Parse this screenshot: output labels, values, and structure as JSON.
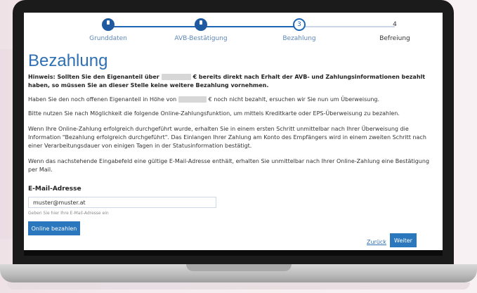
{
  "stepper": {
    "steps": [
      {
        "label": "Grunddaten",
        "state": "done"
      },
      {
        "label": "AVB-Bestätigung",
        "state": "done"
      },
      {
        "label": "Bezahlung",
        "state": "current",
        "number": "3"
      },
      {
        "label": "Befreiung",
        "state": "todo",
        "number": "4"
      }
    ]
  },
  "page": {
    "title": "Bezahlung",
    "hinweis_pre": "Hinweis: Sollten Sie den Eigenanteil über",
    "hinweis_post": "€ bereits direkt nach Erhalt der AVB- und Zahlungsinformationen bezahlt haben, so müssen Sie an dieser Stelle keine weitere Bezahlung vornehmen.",
    "p1_pre": "Haben Sie den noch offenen Eigenanteil in Höhe von",
    "p1_post": "€ noch nicht bezahlt, ersuchen wir Sie nun um Überweisung.",
    "p2": "Bitte nutzen Sie nach Möglichkeit die folgende Online-Zahlungsfunktion, um mittels Kreditkarte oder EPS-Überweisung zu bezahlen.",
    "p3": "Wenn Ihre Online-Zahlung erfolgreich durchgeführt wurde, erhalten Sie in einem ersten Schritt unmittelbar nach Ihrer Überweisung die Information \"Bezahlung erfolgreich durchgeführt\". Das Einlangen Ihrer Zahlung am Konto des Empfängers wird in einem zweiten Schritt nach einer Verarbeitungsdauer von einigen Tagen in der Statusinformation bestätigt.",
    "p4": "Wenn das nachstehende Eingabefeld eine gültige E-Mail-Adresse enthält, erhalten Sie unmittelbar nach Ihrer Online-Zahlung eine Bestätigung per Mail."
  },
  "form": {
    "email_label": "E-Mail-Adresse",
    "email_value": "muster@muster.at",
    "email_hint": "Geben Sie hier Ihre E-Mail-Adresse ein",
    "pay_button": "Online bezahlen"
  },
  "footer": {
    "back_link": "Zurück",
    "next_button": "Weiter"
  },
  "colors": {
    "accent": "#2a77bd",
    "title": "#2f6fb3"
  }
}
